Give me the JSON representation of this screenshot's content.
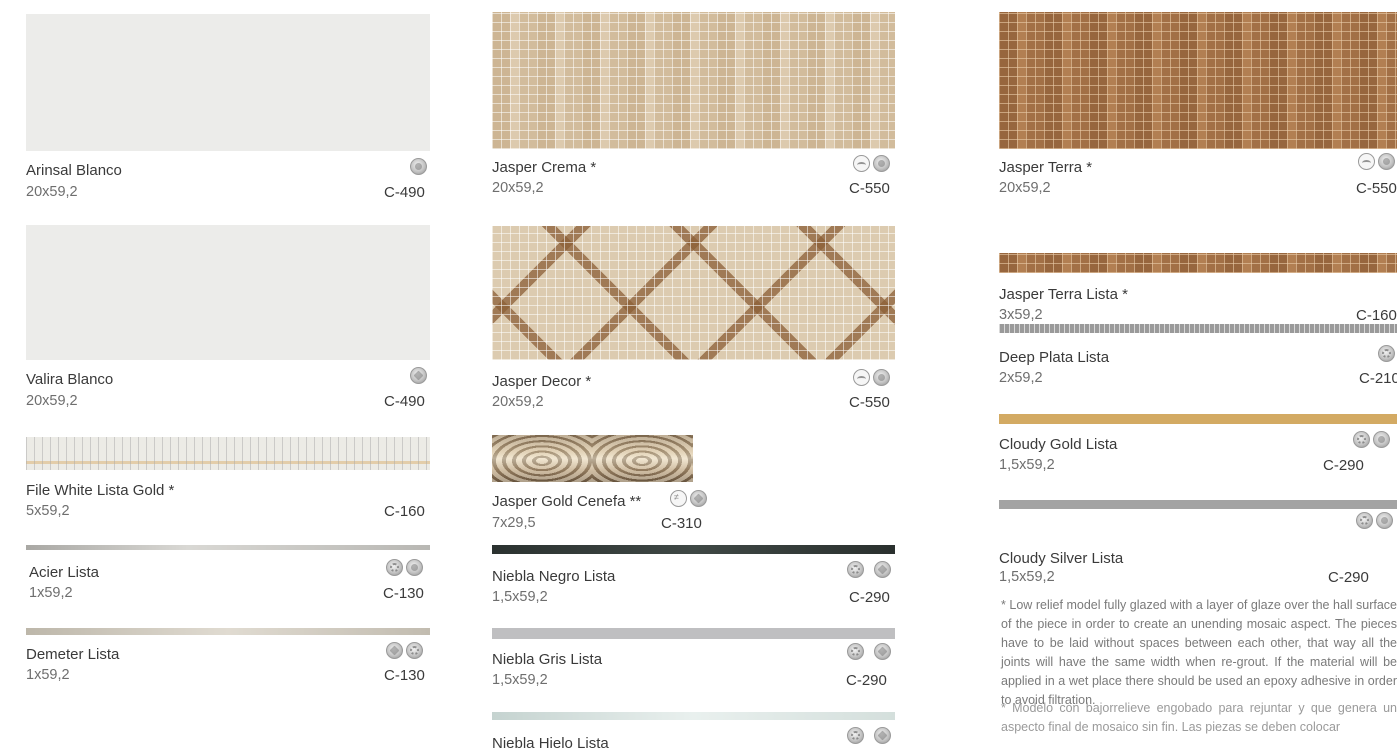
{
  "items": {
    "arinsal_blanco": {
      "name": "Arinsal Blanco",
      "size": "20x59,2",
      "code": "C-490"
    },
    "valira_blanco": {
      "name": "Valira Blanco",
      "size": "20x59,2",
      "code": "C-490"
    },
    "file_white_lista_gold": {
      "name": "File White Lista Gold *",
      "size": "5x59,2",
      "code": "C-160"
    },
    "acier_lista": {
      "name": "Acier Lista",
      "size": "1x59,2",
      "code": "C-130"
    },
    "demeter_lista": {
      "name": "Demeter Lista",
      "size": "1x59,2",
      "code": "C-130"
    },
    "jasper_crema": {
      "name": "Jasper Crema *",
      "size": "20x59,2",
      "code": "C-550"
    },
    "jasper_decor": {
      "name": "Jasper Decor *",
      "size": "20x59,2",
      "code": "C-550"
    },
    "jasper_gold_cenefa": {
      "name": "Jasper Gold Cenefa **",
      "size": "7x29,5",
      "code": "C-310"
    },
    "niebla_negro_lista": {
      "name": "Niebla Negro Lista",
      "size": "1,5x59,2",
      "code": "C-290"
    },
    "niebla_gris_lista": {
      "name": "Niebla Gris Lista",
      "size": "1,5x59,2",
      "code": "C-290"
    },
    "niebla_hielo_lista": {
      "name": "Niebla Hielo Lista"
    },
    "jasper_terra": {
      "name": "Jasper Terra *",
      "size": "20x59,2",
      "code": "C-550"
    },
    "jasper_terra_lista": {
      "name": "Jasper Terra Lista *",
      "size": "3x59,2",
      "code": "C-160"
    },
    "deep_plata_lista": {
      "name": "Deep Plata Lista",
      "size": "2x59,2",
      "code": "C-210"
    },
    "cloudy_gold_lista": {
      "name": "Cloudy Gold Lista",
      "size": "1,5x59,2",
      "code": "C-290"
    },
    "cloudy_silver_lista": {
      "name": "Cloudy Silver Lista",
      "size": "1,5x59,2",
      "code": "C-290"
    }
  },
  "notes": {
    "english": "* Low relief model fully glazed with a layer of glaze over the hall surface of the piece in order to create an unending mosaic aspect. The pieces have to be laid without spaces between each other, that way all the joints will have the same width when re-grout. If the material will be applied in a wet place there should be used an epoxy adhesive in order to avoid filtration.",
    "spanish": "* Modelo con bajorrelieve engobado para rejuntar y que genera un aspecto final de mosaico sin fin. Las piezas se deben colocar"
  },
  "colors": {
    "white_tile": "#ececea",
    "acier": "#c9c8c4",
    "demeter": "#cfcac0",
    "niebla_negro": "#2e3533",
    "niebla_gris": "#bfbfc1",
    "niebla_hielo": "#dfe8e6",
    "cloudy_gold": "#d3aa63",
    "cloudy_silver": "#a3a3a3"
  }
}
